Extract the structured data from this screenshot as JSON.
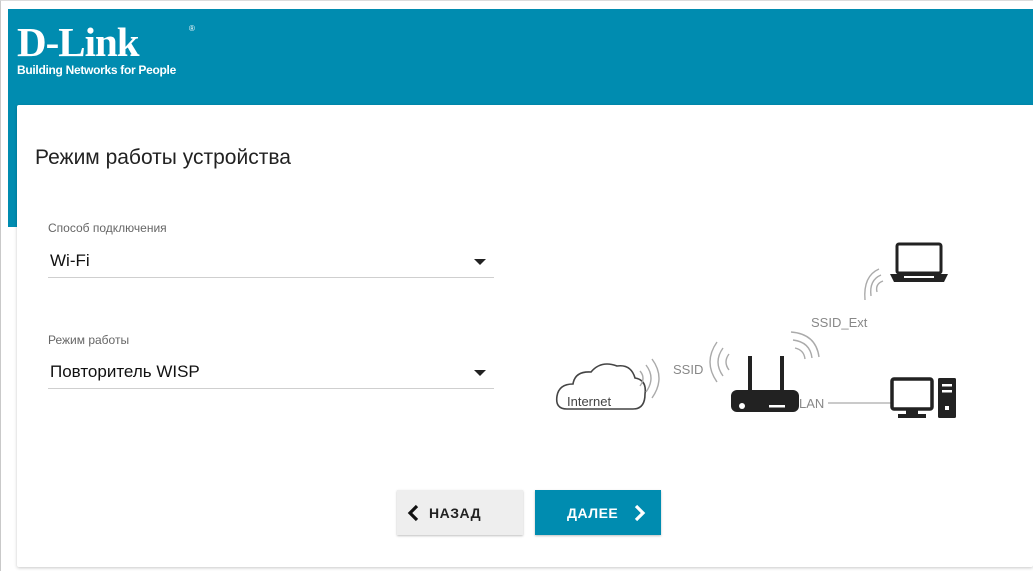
{
  "header": {
    "logo_main": "D-Link",
    "logo_tagline": "Building Networks for People",
    "logo_reg": "®",
    "brand_color": "#008cb0"
  },
  "page": {
    "title": "Режим работы устройства"
  },
  "form": {
    "connection": {
      "label": "Способ подключения",
      "value": "Wi-Fi"
    },
    "mode": {
      "label": "Режим работы",
      "value": "Повторитель WISP"
    }
  },
  "diagram": {
    "internet": "Internet",
    "ssid": "SSID",
    "ssid_ext": "SSID_Ext",
    "lan": "LAN",
    "icons": [
      "cloud-icon",
      "router-icon",
      "laptop-icon",
      "desktop-icon",
      "wifi-waves-icon"
    ]
  },
  "buttons": {
    "back": "НАЗАД",
    "next": "ДАЛЕЕ"
  }
}
